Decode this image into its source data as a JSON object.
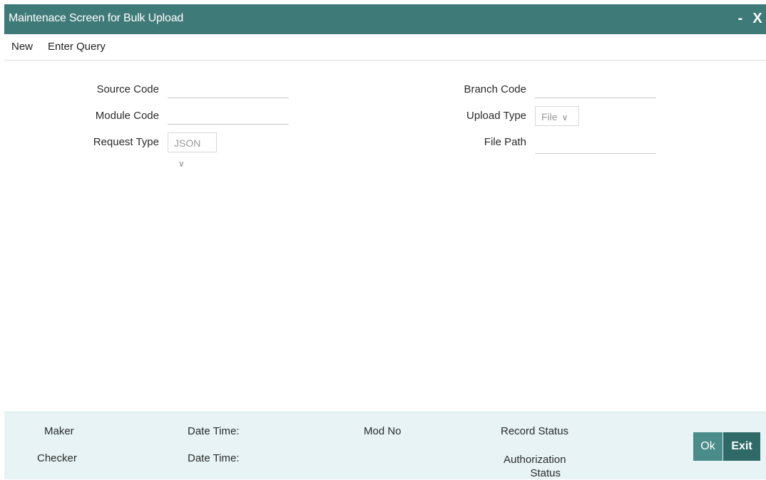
{
  "window": {
    "title": "Maintenace Screen for Bulk Upload",
    "minimize_label": "-",
    "close_label": "X"
  },
  "menu": {
    "new_label": "New",
    "enter_query_label": "Enter Query"
  },
  "form": {
    "source_code": {
      "label": "Source Code",
      "value": ""
    },
    "module_code": {
      "label": "Module Code",
      "value": ""
    },
    "request_type": {
      "label": "Request Type",
      "value": "JSON"
    },
    "branch_code": {
      "label": "Branch Code",
      "value": ""
    },
    "upload_type": {
      "label": "Upload Type",
      "value": "File"
    },
    "file_path": {
      "label": "File Path",
      "value": ""
    }
  },
  "footer": {
    "maker_label": "Maker",
    "checker_label": "Checker",
    "maker_date_time_label": "Date Time:",
    "checker_date_time_label": "Date Time:",
    "mod_no_label": "Mod No",
    "record_status_label": "Record Status",
    "authorization_status_label": "Authorization Status",
    "ok_label": "Ok",
    "exit_label": "Exit"
  },
  "colors": {
    "title_bar": "#3e7a78",
    "footer_bg": "#e7f3f4",
    "ok_button": "#4a8c8a",
    "exit_button": "#2f6a68"
  },
  "icons": {
    "minimize": "minimize-icon",
    "close": "close-icon",
    "dropdown": "chevron-down-icon"
  }
}
